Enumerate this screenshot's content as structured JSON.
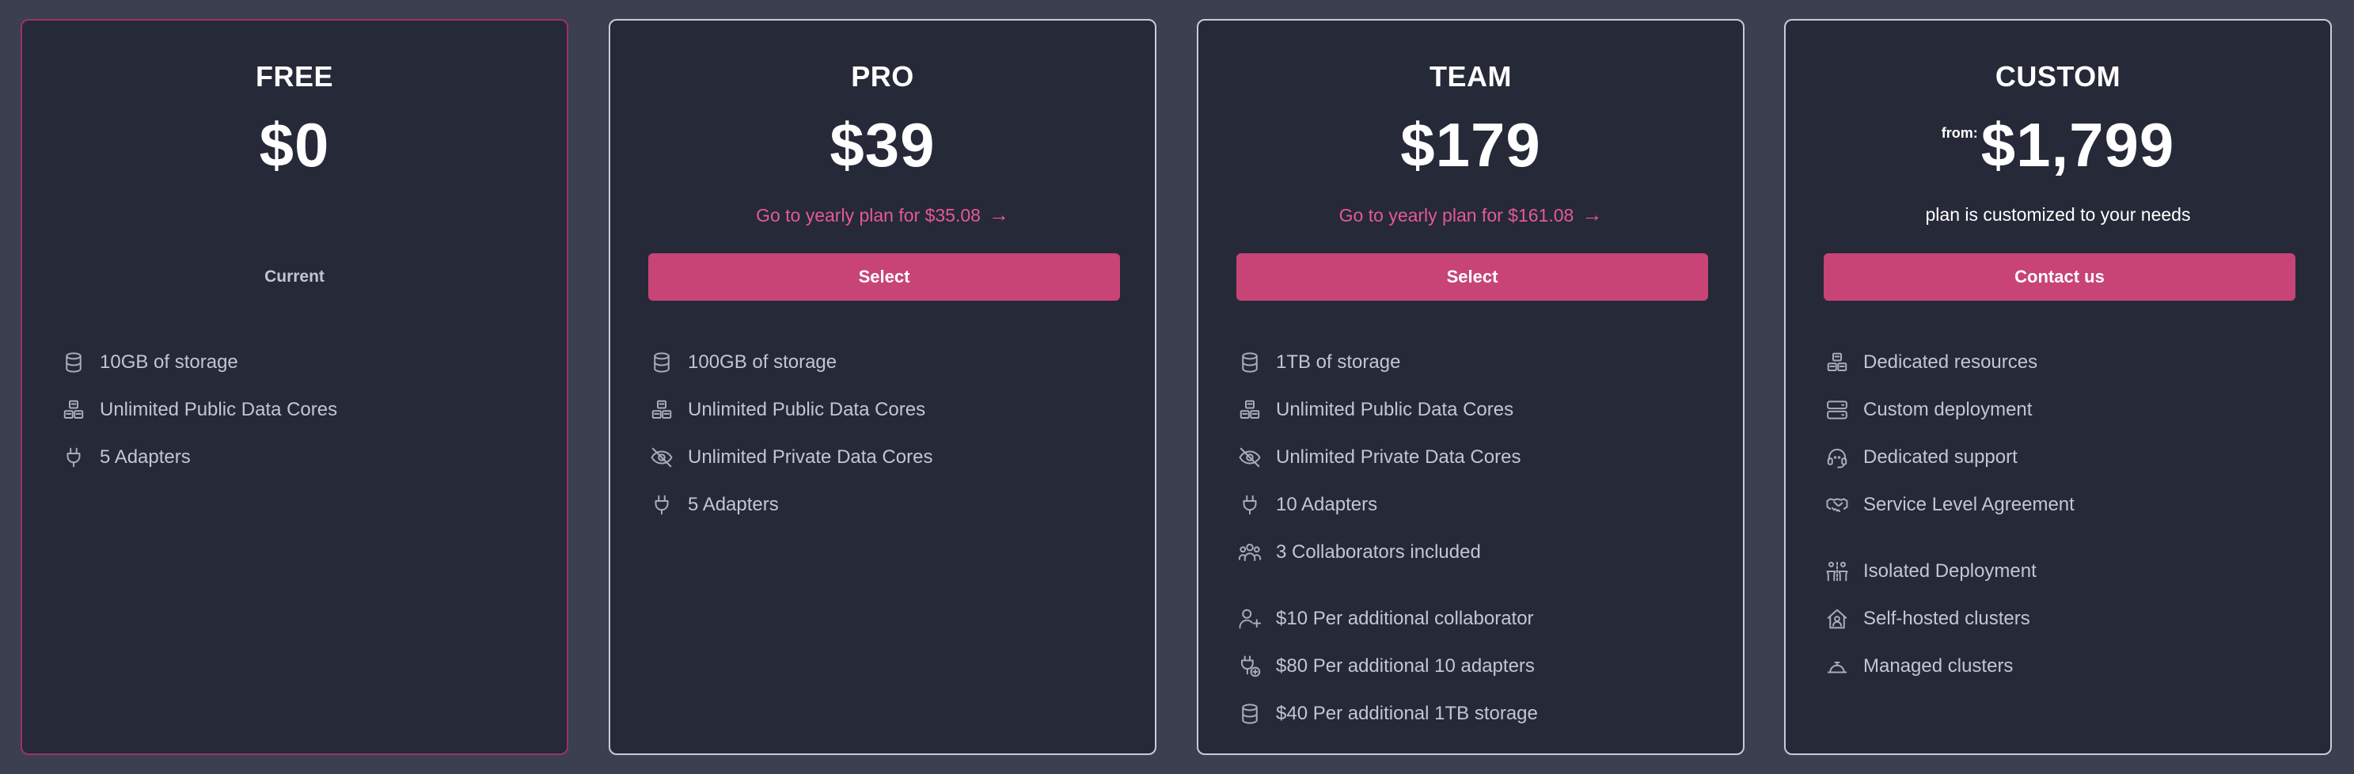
{
  "plans": [
    {
      "title": "FREE",
      "price": "$0",
      "status": "Current",
      "features": [
        {
          "icon": "database-icon",
          "label": "10GB of storage"
        },
        {
          "icon": "cubes-icon",
          "label": "Unlimited Public Data Cores"
        },
        {
          "icon": "plug-icon",
          "label": "5 Adapters"
        }
      ]
    },
    {
      "title": "PRO",
      "price": "$39",
      "yearly_link": "Go to yearly plan for $35.08",
      "arrow": "→",
      "button": "Select",
      "features": [
        {
          "icon": "database-icon",
          "label": "100GB of storage"
        },
        {
          "icon": "cubes-icon",
          "label": "Unlimited Public Data Cores"
        },
        {
          "icon": "eye-off-icon",
          "label": "Unlimited Private Data Cores"
        },
        {
          "icon": "plug-icon",
          "label": "5 Adapters"
        }
      ]
    },
    {
      "title": "TEAM",
      "price": "$179",
      "yearly_link": "Go to yearly plan for $161.08",
      "arrow": "→",
      "button": "Select",
      "features": [
        {
          "icon": "database-icon",
          "label": "1TB of storage"
        },
        {
          "icon": "cubes-icon",
          "label": "Unlimited Public Data Cores"
        },
        {
          "icon": "eye-off-icon",
          "label": "Unlimited Private Data Cores"
        },
        {
          "icon": "plug-icon",
          "label": "10 Adapters"
        },
        {
          "icon": "users-icon",
          "label": "3 Collaborators included"
        }
      ],
      "extras": [
        {
          "icon": "user-plus-icon",
          "label": "$10 Per additional collaborator"
        },
        {
          "icon": "plug-plus-icon",
          "label": "$80 Per additional 10 adapters"
        },
        {
          "icon": "database-icon",
          "label": "$40 Per additional 1TB storage"
        }
      ]
    },
    {
      "title": "CUSTOM",
      "price_prefix": "from:",
      "price": "$1,799",
      "subtitle": "plan is customized to your needs",
      "button": "Contact us",
      "features": [
        {
          "icon": "cubes-icon",
          "label": "Dedicated resources"
        },
        {
          "icon": "server-icon",
          "label": "Custom deployment"
        },
        {
          "icon": "headset-icon",
          "label": "Dedicated support"
        },
        {
          "icon": "handshake-icon",
          "label": "Service Level Agreement"
        }
      ],
      "extras": [
        {
          "icon": "isolated-people-icon",
          "label": "Isolated Deployment"
        },
        {
          "icon": "home-user-icon",
          "label": "Self-hosted clusters"
        },
        {
          "icon": "bell-service-icon",
          "label": "Managed clusters"
        }
      ]
    }
  ],
  "colors": {
    "page_bg": "#3b3f50",
    "card_bg": "#252938",
    "accent": "#c84476",
    "link": "#e45a91",
    "current_border": "#9c3365"
  }
}
